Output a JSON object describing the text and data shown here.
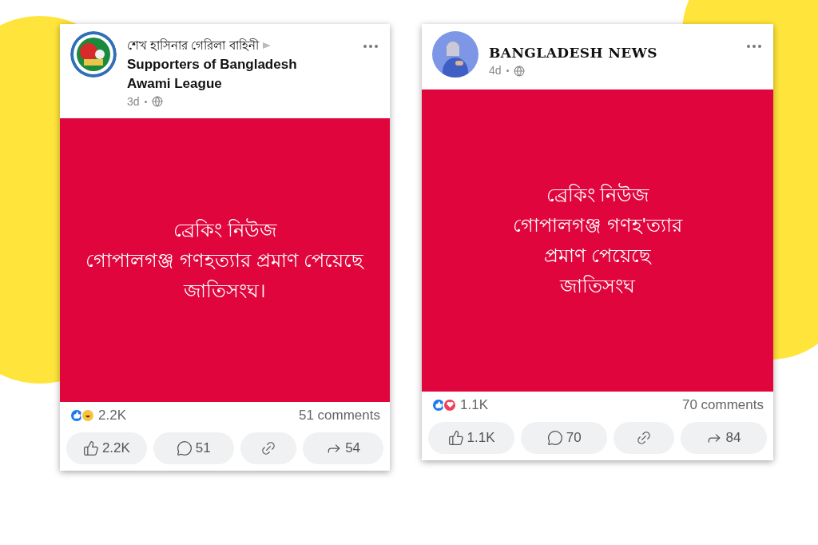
{
  "posts": [
    {
      "group": "শেখ হাসিনার গেরিলা বাহিনী",
      "name": "Supporters of Bangladesh Awami League",
      "time": "3d",
      "text_lines": [
        "ব্রেকিং নিউজ",
        "গোপালগঞ্জ গণহত্যার প্রমাণ পেয়েছে",
        "জাতিসংঘ।"
      ],
      "reactions": [
        {
          "kind": "like"
        },
        {
          "kind": "haha"
        }
      ],
      "reaction_count": "2.2K",
      "comments": "51 comments",
      "actions": [
        {
          "kind": "like",
          "label": "2.2K"
        },
        {
          "kind": "comment",
          "label": "51"
        },
        {
          "kind": "link"
        },
        {
          "kind": "share",
          "label": "54"
        }
      ]
    },
    {
      "name": "BANGLADESH NEWS",
      "time": "4d",
      "text_lines": [
        "ব্রেকিং নিউজ",
        "গোপালগঞ্জ গণহ'ত্যার",
        "প্রমাণ পেয়েছে",
        "জাতিসংঘ"
      ],
      "reactions": [
        {
          "kind": "like"
        },
        {
          "kind": "love"
        }
      ],
      "reaction_count": "1.1K",
      "comments": "70 comments",
      "actions": [
        {
          "kind": "like",
          "label": "1.1K"
        },
        {
          "kind": "comment",
          "label": "70"
        },
        {
          "kind": "link"
        },
        {
          "kind": "share",
          "label": "84"
        }
      ]
    }
  ]
}
